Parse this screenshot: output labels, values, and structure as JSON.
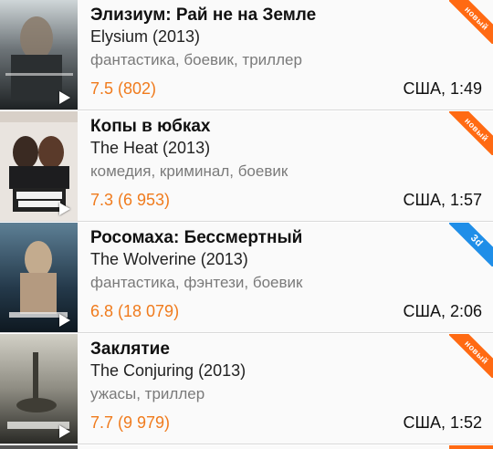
{
  "colors": {
    "rating": "#f07b1d",
    "badge_new": "#ff6a13",
    "badge_3d": "#1f8ee8"
  },
  "movies": [
    {
      "title": "Элизиум: Рай не на Земле",
      "original": "Elysium (2013)",
      "genres": "фантастика, боевик, триллер",
      "rating": "7.5 (802)",
      "meta": "США, 1:49",
      "badge": "новый",
      "badge_color": "#ff6a13",
      "poster_icon": "play-icon"
    },
    {
      "title": "Копы в юбках",
      "original": "The Heat (2013)",
      "genres": "комедия, криминал, боевик",
      "rating": "7.3 (6 953)",
      "meta": "США, 1:57",
      "badge": "новый",
      "badge_color": "#ff6a13",
      "poster_icon": "play-icon"
    },
    {
      "title": "Росомаха: Бессмертный",
      "original": "The Wolverine (2013)",
      "genres": "фантастика, фэнтези, боевик",
      "rating": "6.8 (18 079)",
      "meta": "США, 2:06",
      "badge": "3D",
      "badge_color": "#1f8ee8",
      "poster_icon": "play-icon"
    },
    {
      "title": "Заклятие",
      "original": "The Conjuring (2013)",
      "genres": "ужасы, триллер",
      "rating": "7.7 (9 979)",
      "meta": "США, 1:52",
      "badge": "новый",
      "badge_color": "#ff6a13",
      "poster_icon": "play-icon"
    }
  ]
}
